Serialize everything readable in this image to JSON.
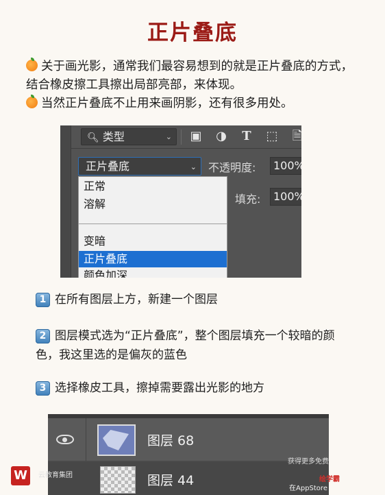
{
  "title": "正片叠底",
  "intro": {
    "line1": "关于画光影，通常我们最容易想到的就是正片叠底的方式，",
    "line2": "结合橡皮擦工具擦出局部亮部，来体现。",
    "line3": "当然正片叠底不止用来画阴影，还有很多用处。"
  },
  "ps_panel": {
    "kind_label": "类型",
    "blend_mode": "正片叠底",
    "opacity_label": "不透明度:",
    "opacity_value": "100%",
    "fill_label": "填充:",
    "fill_value": "100%",
    "menu_items": [
      "正常",
      "溶解",
      "变暗",
      "正片叠底",
      "颜色加深"
    ],
    "selected_index": 3
  },
  "steps": [
    {
      "num": "1",
      "line1": "在所有图层上方，新建一个图层",
      "line2": ""
    },
    {
      "num": "2",
      "line1": "图层模式选为“正片叠底”，整个图层填充一个较暗的颜",
      "line2": "色，我这里选的是偏灰的蓝色"
    },
    {
      "num": "3",
      "line1": "选择橡皮工具，擦掉需要露出光影的地方",
      "line2": ""
    }
  ],
  "layers_panel": {
    "layer1": "图层 68",
    "layer2": "图层 44"
  },
  "watermark": {
    "logo_text": "W",
    "left_text": "云教育集团",
    "right_text": "获得更多免费",
    "store_text": "在AppStore",
    "brand_text": "绘学霸"
  },
  "colors": {
    "title": "#9b1b16",
    "selected": "#1d6fd1",
    "background": "#fbf8f3"
  }
}
